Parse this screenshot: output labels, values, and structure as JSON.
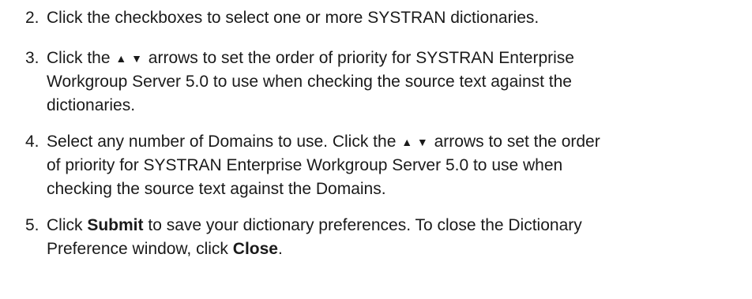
{
  "steps": [
    {
      "number": "2.",
      "lines": [
        "Click the checkboxes to select one or more SYSTRAN dictionaries."
      ]
    },
    {
      "number": "3.",
      "line1_pre": "Click the",
      "up_icon": "triangle-up-icon",
      "down_icon": "triangle-down-icon",
      "line1_post": "arrows to set the order of priority for SYSTRAN Enterprise",
      "line2": "Workgroup Server 5.0 to use when checking the source text against the",
      "line3": "dictionaries."
    },
    {
      "number": "4.",
      "line1_pre": "Select any number of Domains to use. Click the",
      "line1_post": "arrows to set the order",
      "line2": "of priority for SYSTRAN Enterprise Workgroup Server 5.0 to use when",
      "line3": "checking the source text against the Domains."
    },
    {
      "number": "5.",
      "line1_pre": "Click",
      "submit_label": "Submit",
      "line1_post": "to save your dictionary preferences. To close the Dictionary",
      "line2_pre": "Preference window, click",
      "close_label": "Close",
      "line2_post": "."
    }
  ],
  "glyphs": {
    "up": "▲",
    "down": "▼"
  }
}
